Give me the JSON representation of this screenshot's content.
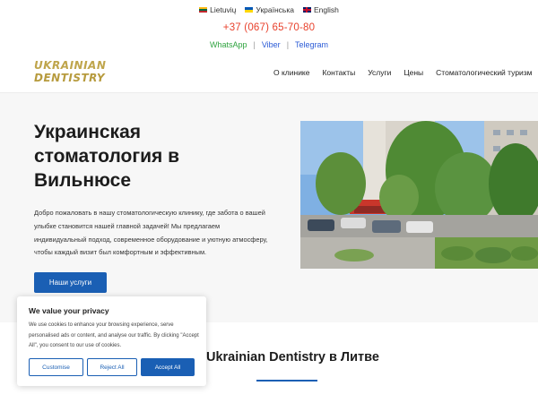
{
  "languages": [
    {
      "label": "Lietuvių",
      "flag": "lithuania-flag-icon"
    },
    {
      "label": "Українська",
      "flag": "ukraine-flag-icon"
    },
    {
      "label": "English",
      "flag": "uk-flag-icon"
    }
  ],
  "contact": {
    "phone": "+37 (067) 65-70-80",
    "whatsapp": "WhatsApp",
    "viber": "Viber",
    "telegram": "Telegram",
    "separator": "|"
  },
  "logo": {
    "line1": "UKRAINIAN",
    "line2": "DENTISTRY"
  },
  "nav": [
    "О клинике",
    "Контакты",
    "Услуги",
    "Цены",
    "Стоматологический туризм"
  ],
  "hero": {
    "title": "Украинская стоматология в Вильнюсе",
    "text": "Добро пожаловать в нашу стоматологическую клинику, где забота о вашей улыбке становится нашей главной задачей! Мы предлагаем индивидуальный подход, современное оборудование и уютную атмосферу, чтобы каждый визит был комфортным и эффективным.",
    "button": "Наши услуги"
  },
  "section": {
    "title": "Ukrainian Dentistry в Литве"
  },
  "cookie": {
    "title": "We value your privacy",
    "text": "We use cookies to enhance your browsing experience, serve personalised ads or content, and analyse our traffic. By clicking \"Accept All\", you consent to our use of cookies.",
    "customise": "Customise",
    "reject": "Reject All",
    "accept": "Accept All"
  },
  "colors": {
    "accent": "#1a5fb4",
    "phone": "#e8412c",
    "whatsapp": "#2fa33f",
    "logo": "#bfa54c"
  }
}
